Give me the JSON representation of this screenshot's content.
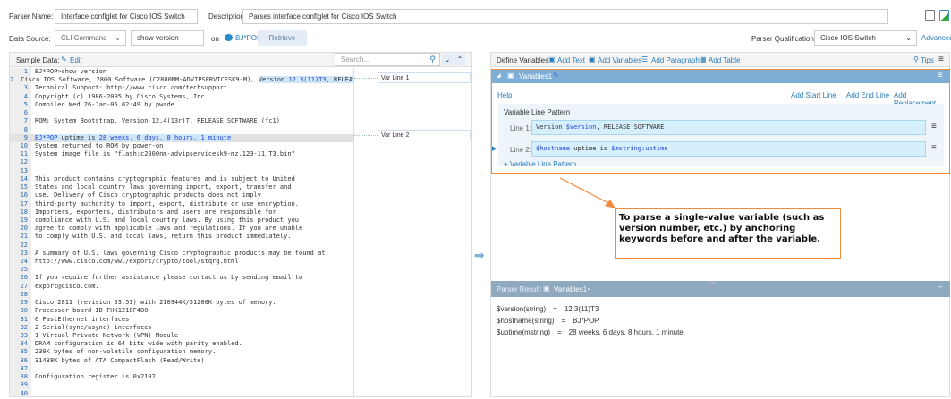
{
  "header": {
    "parser_name_label": "Parser Name:",
    "parser_name": "Interface configlet for Cisco IOS Switch",
    "description_label": "Description:",
    "description": "Parses interface configlet for Cisco IOS Switch",
    "data_source_label": "Data Source:",
    "data_source": "CLI Command",
    "command": "show version",
    "on_label": "on",
    "device": "BJ*POP",
    "retrieve": "Retrieve",
    "qualification_label": "Parser Qualification:",
    "qualification": "Cisco IOS Switch",
    "advanced": "Advanced"
  },
  "sample": {
    "label": "Sample Data:",
    "edit": "Edit",
    "search_placeholder": "Search...",
    "var_line_1": "Var Line 1",
    "var_line_2": "Var Line 2",
    "lines": [
      [
        [
          "BJ*POP>show version",
          ""
        ]
      ],
      [
        [
          "Cisco IOS Software, 2800 Software (C2800NM-ADVIPSERVICESK9-M), ",
          ""
        ],
        [
          "Version ",
          "hl"
        ],
        [
          "12.3(11)T3",
          "hl var"
        ],
        [
          ", RELEASE SOF",
          "hl"
        ]
      ],
      [
        [
          "Technical Support: http://www.cisco.com/techsupport",
          ""
        ]
      ],
      [
        [
          "Copyright (c) 1986-2005 by Cisco Systems, Inc.",
          ""
        ]
      ],
      [
        [
          "Compiled Wed 26-Jan-05 02:49 by pwade",
          ""
        ]
      ],
      [
        [
          "",
          ""
        ]
      ],
      [
        [
          "ROM: System Bootstrap, Version 12.4(13r)T, RELEASE SOFTWARE (fc1)",
          ""
        ]
      ],
      [
        [
          "",
          ""
        ]
      ],
      [
        [
          "BJ*POP",
          "hl var"
        ],
        [
          " uptime is ",
          "hl"
        ],
        [
          "28 weeks, 6 days, 8 hours, 1 minute",
          "hl var"
        ]
      ],
      [
        [
          "System returned to ROM by power-on",
          ""
        ]
      ],
      [
        [
          "System image file is \"flash:c2800nm-advipservicesk9-mz.123-11.T3.bin\"",
          ""
        ]
      ],
      [
        [
          "",
          ""
        ]
      ],
      [
        [
          "",
          ""
        ]
      ],
      [
        [
          "This product contains cryptographic features and is subject to United",
          ""
        ]
      ],
      [
        [
          "States and local country laws governing import, export, transfer and",
          ""
        ]
      ],
      [
        [
          "use. Delivery of Cisco cryptographic products does not imply",
          ""
        ]
      ],
      [
        [
          "third-party authority to import, export, distribute or use encryption.",
          ""
        ]
      ],
      [
        [
          "Importers, exporters, distributors and users are responsible for",
          ""
        ]
      ],
      [
        [
          "compliance with U.S. and local country laws. By using this product you",
          ""
        ]
      ],
      [
        [
          "agree to comply with applicable laws and regulations. If you are unable",
          ""
        ]
      ],
      [
        [
          "to comply with U.S. and local laws, return this product immediately.",
          ""
        ]
      ],
      [
        [
          "",
          ""
        ]
      ],
      [
        [
          "A summary of U.S. laws governing Cisco cryptographic products may be found at:",
          ""
        ]
      ],
      [
        [
          "http://www.cisco.com/wwl/export/crypto/tool/stqrg.html",
          ""
        ]
      ],
      [
        [
          "",
          ""
        ]
      ],
      [
        [
          "If you require further assistance please contact us by sending email to",
          ""
        ]
      ],
      [
        [
          "export@cisco.com.",
          ""
        ]
      ],
      [
        [
          "",
          ""
        ]
      ],
      [
        [
          "Cisco 2811 (revision 53.51) with 210944K/51200K bytes of memory.",
          ""
        ]
      ],
      [
        [
          "Processor board ID FHK1218F480",
          ""
        ]
      ],
      [
        [
          "6 FastEthernet interfaces",
          ""
        ]
      ],
      [
        [
          "2 Serial(sync/async) interfaces",
          ""
        ]
      ],
      [
        [
          "1 Virtual Private Network (VPN) Module",
          ""
        ]
      ],
      [
        [
          "DRAM configuration is 64 bits wide with parity enabled.",
          ""
        ]
      ],
      [
        [
          "239K bytes of non-volatile configuration memory.",
          ""
        ]
      ],
      [
        [
          "31488K bytes of ATA CompactFlash (Read/Write)",
          ""
        ]
      ],
      [
        [
          "",
          ""
        ]
      ],
      [
        [
          "Configuration register is 0x2102",
          ""
        ]
      ],
      [
        [
          "",
          ""
        ]
      ],
      [
        [
          "",
          ""
        ]
      ]
    ]
  },
  "define": {
    "title": "Define Variables",
    "add_text": "Add Text",
    "add_variables": "Add Variables",
    "add_paragraph": "Add Paragraph",
    "add_table": "Add Table",
    "tips": "Tips"
  },
  "variables": {
    "name": "Variables1",
    "help": "Help",
    "add_start": "Add Start Line",
    "add_end": "Add End Line",
    "add_replacement": "Add Replacement",
    "pattern_title": "Variable Line Pattern",
    "line1_label": "Line 1:",
    "line1": [
      [
        "Version ",
        ""
      ],
      [
        "$version",
        "var"
      ],
      [
        ", RELEASE SOFTWARE",
        ""
      ]
    ],
    "line2_label": "Line 2:",
    "line2": [
      [
        "$hostname",
        "var"
      ],
      [
        " uptime is ",
        ""
      ],
      [
        "$mstring:uptime",
        "var"
      ]
    ],
    "add_pattern": "+ Variable Line Pattern"
  },
  "callout": "To parse a single-value variable (such as version number, etc.) by anchoring keywords before and after the variable.",
  "result": {
    "label": "Parser Result:",
    "name": "Variables1",
    "rows": [
      {
        "k": "$version(string)",
        "v": "12.3(11)T3"
      },
      {
        "k": "$hostname(string)",
        "v": "BJ*POP"
      },
      {
        "k": "$uptime(mstring)",
        "v": "28 weeks, 6 days, 8 hours, 1 minute"
      }
    ]
  },
  "colors": {
    "accent": "#2a7ab8",
    "orange": "#f08a3c",
    "bar": "#7eaed6"
  }
}
